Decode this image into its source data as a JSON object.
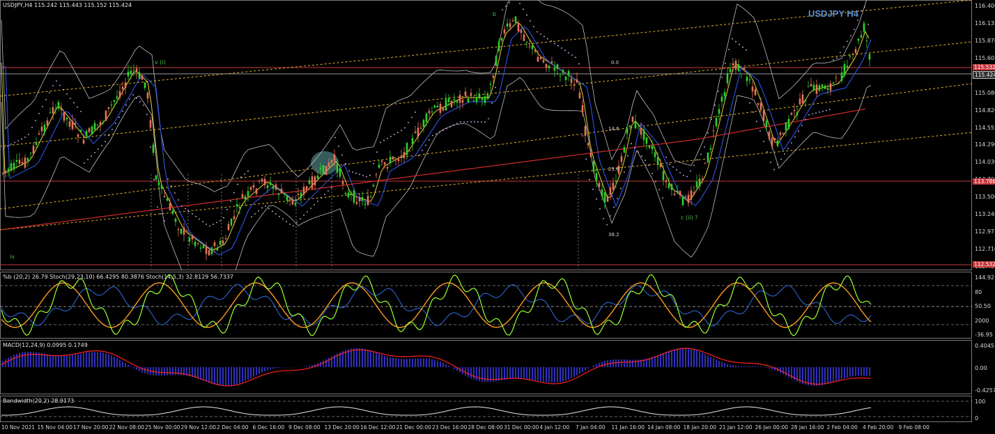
{
  "main": {
    "header": "USDJPY,H4  115.242 115.443 115.152 115.424",
    "title": "USDJPY H4",
    "price_axis": [
      "116.400",
      "116.135",
      "115.870",
      "115.605",
      "115.346",
      "115.080",
      "114.820",
      "114.555",
      "114.290",
      "114.030",
      "113.765",
      "113.500",
      "113.240",
      "112.975",
      "112.710",
      "112.450"
    ],
    "price_tags": {
      "upper": "115.532",
      "current": "115.424",
      "mid": "113.786",
      "lower": "112.532"
    },
    "wave_labels": {
      "v": "v (i)",
      "b": "b",
      "c": "c (ii) ?",
      "iv": "iv"
    },
    "fib_labels": {
      "f0": "0.0",
      "f14": "14.6",
      "f236": "23.6",
      "f382": "38.2"
    }
  },
  "stoch": {
    "header": "%b (20,2) 26.79  Stoch(29,23,10) 66.4295 80.3876  Stoch(14,5,3) 32.8129 56.7337",
    "axis": [
      "144.92",
      "80",
      "50.50",
      "2000",
      "-36.95"
    ]
  },
  "macd": {
    "header": "MACD(12,24,9) 0.0995 0.1749",
    "axis": [
      "0.4045",
      "0.00",
      "-0.4257"
    ]
  },
  "bandwidth": {
    "header": "Bandwidth(20,2) 28.9173",
    "axis": [
      "100",
      "0"
    ]
  },
  "time_axis": [
    "10 Nov 2021",
    "15 Nov 04:00",
    "17 Nov 20:00",
    "22 Nov 08:00",
    "25 Nov 00:00",
    "29 Nov 12:00",
    "2 Dec 04:00",
    "6 Dec 16:00",
    "9 Dec 08:00",
    "13 Dec 20:00",
    "16 Dec 12:00",
    "21 Dec 00:00",
    "23 Dec 16:00",
    "28 Dec 08:00",
    "31 Dec 00:00",
    "4 Jan 12:00",
    "7 Jan 04:00",
    "11 Jan 16:00",
    "14 Jan 08:00",
    "18 Jan 20:00",
    "21 Jan 12:00",
    "26 Jan 00:00",
    "28 Jan 16:00",
    "2 Feb 04:00",
    "4 Feb 20:00",
    "9 Feb 08:00"
  ],
  "colors": {
    "bull": "#2fd12f",
    "bear": "#e8735a",
    "ma_slow": "#d22b2b",
    "ma_mid": "#2a4fd6",
    "ma_fast": "#e3d23a",
    "bands": "#bdbdbd",
    "sar": "#d9c3ff",
    "channel": "#e2b02d",
    "stoch_fast": "#9aff2f",
    "stoch_slow": "#ff9a1f",
    "macd_signal": "#ff2020",
    "macd_hist": "#2f2fbf"
  }
}
